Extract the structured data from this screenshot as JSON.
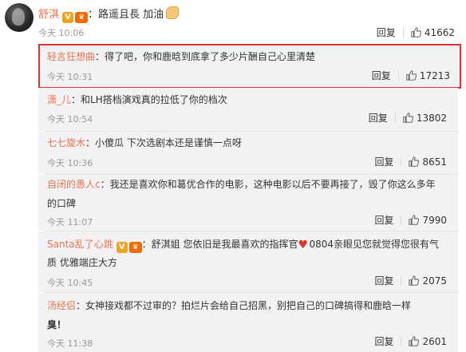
{
  "post": {
    "user": "舒淇",
    "text": "：路遥且長 加油",
    "time": "今天 10:06",
    "reply": "回复",
    "likes": "41662"
  },
  "comments": [
    {
      "user": "轻言狂想曲",
      "text": "：得了吧，你和鹿晗到底拿了多少片酬自己心里清楚",
      "time": "今天 10:31",
      "reply": "回复",
      "likes": "17213"
    },
    {
      "user": "潇_儿",
      "text": "：和LH搭档演戏真的拉低了你的档次",
      "time": "今天 10:54",
      "reply": "回复",
      "likes": "13802"
    },
    {
      "user": "七七旋木",
      "text": "：小傻瓜 下次选剧本还是谨慎一点呀",
      "time": "今天 10:36",
      "reply": "回复",
      "likes": "8651"
    },
    {
      "user": "自闭的愚人c",
      "text": "：我还是喜欢你和葛优合作的电影，这种电影以后不要再接了，毁了你这么多年",
      "text2": "的口碑",
      "time": "今天 11:07",
      "reply": "回复",
      "likes": "7990"
    },
    {
      "user": "Santa乱了心跳",
      "text_a": "：舒淇姐 您依旧是我最喜欢的指挥官",
      "text_b": "0804亲眼见您就觉得您很有气",
      "text2": "质 优雅端庄大方",
      "time": "今天 10:45",
      "reply": "回复",
      "likes": "2075"
    },
    {
      "user": "汤经侣",
      "text": "：女神接戏都不过审的？拍烂片会给自己招黑，别把自己的口碑搞得和鹿晗一样",
      "text2": "臭！",
      "time": "今天 11:38",
      "reply": "回复",
      "likes": "2601"
    }
  ],
  "icons": {
    "thumb": "thumbs-up-icon",
    "verified": "verified-badge-icon",
    "vip": "vip-badge-icon",
    "heart": "heart-icon",
    "muscle": "flexed-biceps-icon"
  }
}
